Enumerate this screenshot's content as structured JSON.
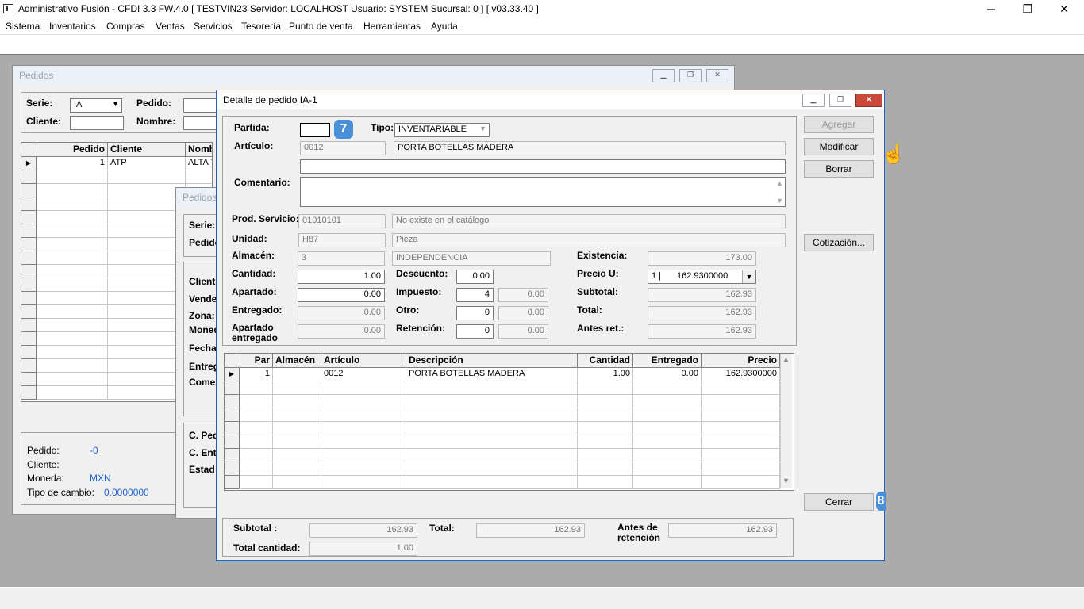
{
  "app": {
    "title": "Administrativo Fusión - CFDI 3.3 FW.4.0 [ TESTVIN23  Servidor: LOCALHOST   Usuario: SYSTEM     Sucursal: 0 ] [ v03.33.40 ]",
    "controls": {
      "minimize": "─",
      "maximize": "❐",
      "close": "✕"
    }
  },
  "menu": [
    "Sistema",
    "Inventarios",
    "Compras",
    "Ventas",
    "Servicios",
    "Tesorería",
    "Punto de venta",
    "Herramientas",
    "Ayuda"
  ],
  "pedidos": {
    "title": "Pedidos",
    "serie_label": "Serie:",
    "serie_value": "IA",
    "pedido_label": "Pedido:",
    "cliente_label": "Cliente:",
    "nombre_label": "Nombre:",
    "columns": [
      "Pedido",
      "Cliente",
      "Nombr"
    ],
    "rows": [
      {
        "pedido": "1",
        "cliente": "ATP",
        "nombre": "ALTA TE"
      }
    ],
    "summary": {
      "pedido_label": "Pedido:",
      "pedido_value": "-0",
      "cliente_label": "Cliente:",
      "moneda_label": "Moneda:",
      "moneda_value": "MXN",
      "tc_label": "Tipo de cambio:",
      "tc_value": "0.0000000"
    }
  },
  "pedidos2": {
    "title": "Pedidos",
    "labels": [
      "Serie:",
      "Pedido",
      "Cliente",
      "Vende",
      "Zona:",
      "Moned",
      "Fecha",
      "Entreg",
      "Comer",
      "C. Ped",
      "C. Entr",
      "Estad"
    ]
  },
  "detalle": {
    "title": "Detalle de pedido IA-1",
    "partida_label": "Partida:",
    "partida_value": "",
    "tipo_label": "Tipo:",
    "tipo_value": "INVENTARIABLE",
    "articulo_label": "Artículo:",
    "articulo_code": "0012",
    "articulo_desc": "PORTA BOTELLAS MADERA",
    "comentario_label": "Comentario:",
    "prod_label": "Prod. Servicio:",
    "prod_code": "01010101",
    "prod_desc": "No existe en el catálogo",
    "unidad_label": "Unidad:",
    "unidad_code": "H87",
    "unidad_desc": "Pieza",
    "almacen_label": "Almacén:",
    "almacen_code": "3",
    "almacen_desc": "INDEPENDENCIA",
    "existencia_label": "Existencia:",
    "existencia_value": "173.00",
    "cantidad_label": "Cantidad:",
    "cantidad_value": "1.00",
    "descuento_label": "Descuento:",
    "descuento_value": "0.00",
    "preciou_label": "Precio U:",
    "preciou_list": "1 |",
    "preciou_value": "162.9300000",
    "apartado_label": "Apartado:",
    "apartado_value": "0.00",
    "impuesto_label": "Impuesto:",
    "impuesto_code": "4",
    "impuesto_value": "0.00",
    "subtotal_label": "Subtotal:",
    "subtotal_value": "162.93",
    "entregado_label": "Entregado:",
    "entregado_value": "0.00",
    "otro_label": "Otro:",
    "otro_code": "0",
    "otro_value": "0.00",
    "total_label": "Total:",
    "total_value": "162.93",
    "apent_label1": "Apartado",
    "apent_label2": "entregado",
    "apent_value": "0.00",
    "retencion_label": "Retención:",
    "retencion_code": "0",
    "retencion_value": "0.00",
    "antesret_label": "Antes ret.:",
    "antesret_value": "162.93",
    "buttons": {
      "agregar": "Agregar",
      "modificar": "Modificar",
      "borrar": "Borrar",
      "cotizacion": "Cotización...",
      "cerrar": "Cerrar"
    },
    "grid_columns": [
      "Par",
      "Almacén",
      "Artículo",
      "Descripción",
      "Cantidad",
      "Entregado",
      "Precio"
    ],
    "grid_rows": [
      {
        "par": "1",
        "almacen": "",
        "articulo": "0012",
        "descripcion": "PORTA BOTELLAS MADERA",
        "cantidad": "1.00",
        "entregado": "0.00",
        "precio": "162.9300000"
      }
    ],
    "footer": {
      "subtotal_label": "Subtotal :",
      "subtotal_value": "162.93",
      "total_label": "Total:",
      "total_value": "162.93",
      "antes_label1": "Antes de",
      "antes_label2": "retención",
      "antes_value": "162.93",
      "totcant_label": "Total cantidad:",
      "totcant_value": "1.00"
    },
    "badges": {
      "step7": "7",
      "step8": "8"
    }
  }
}
